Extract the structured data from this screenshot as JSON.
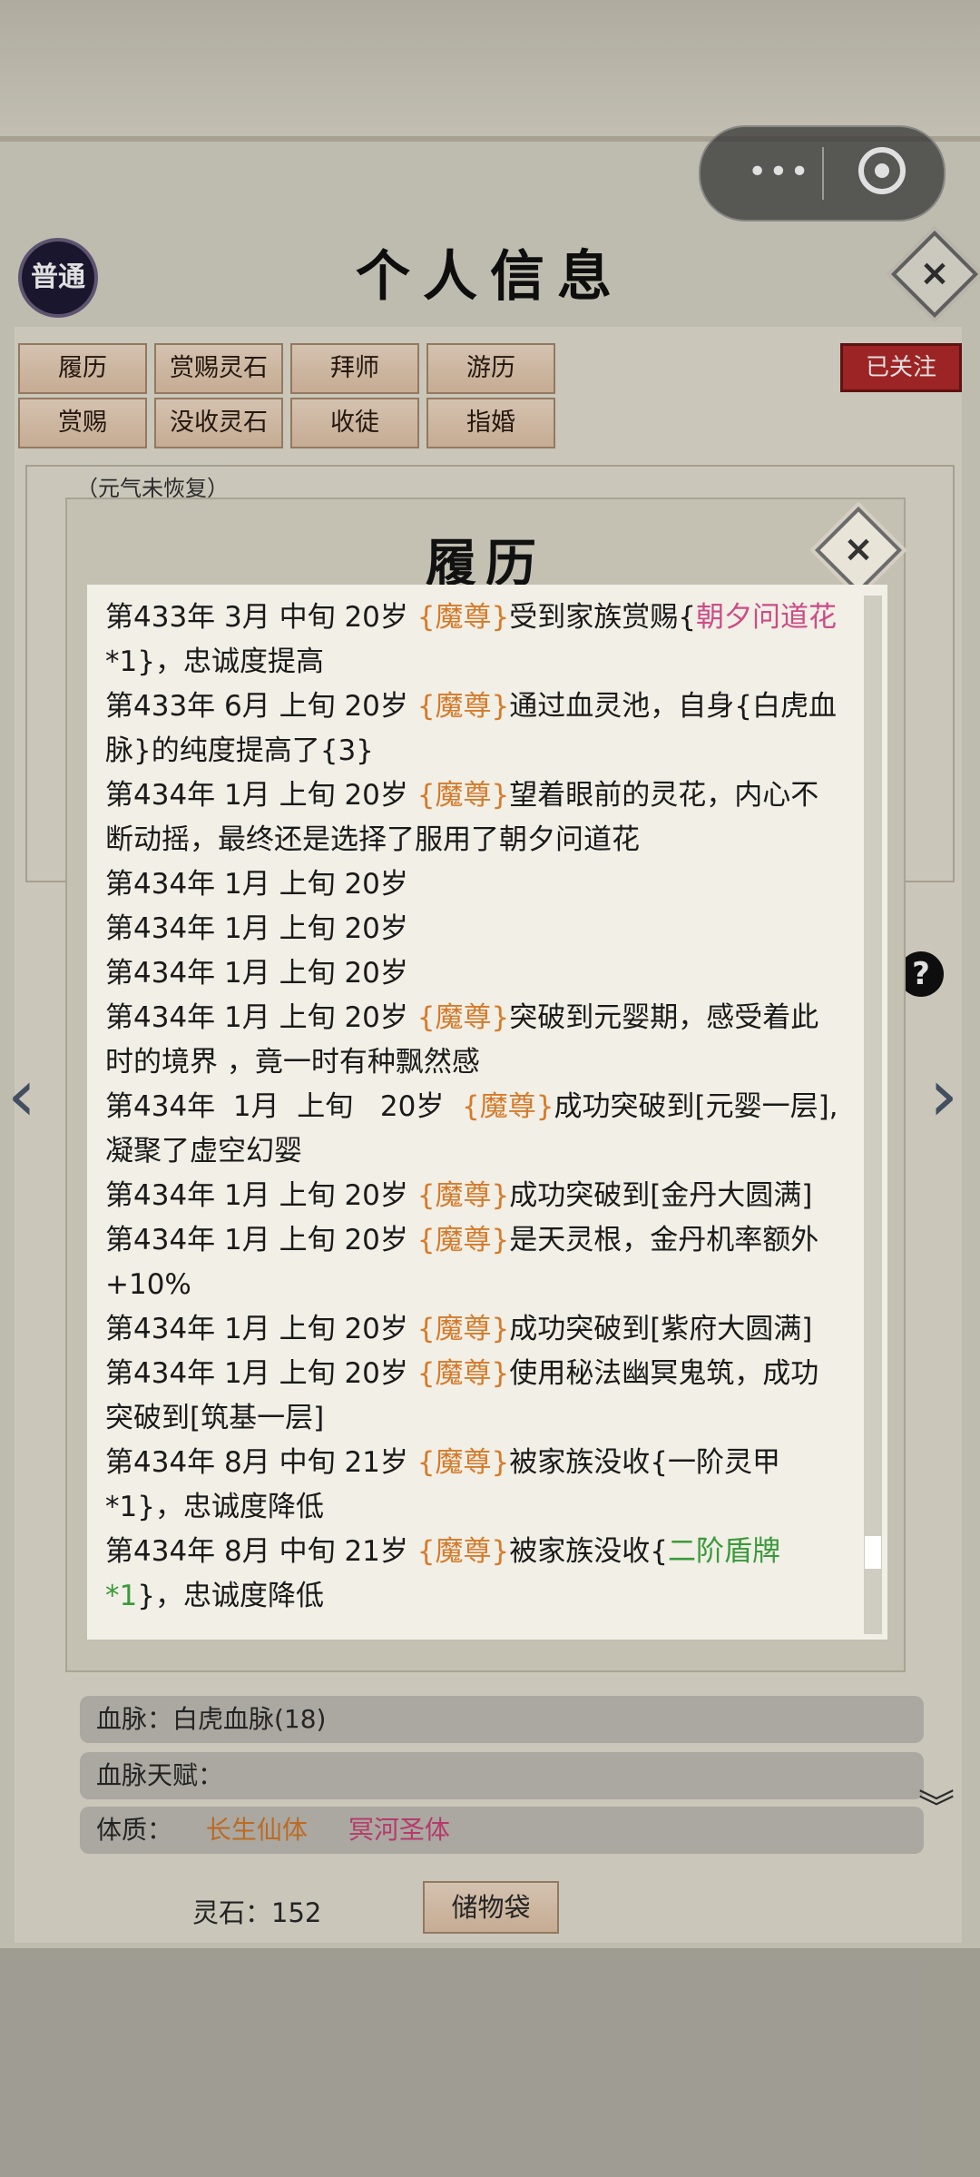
{
  "header": {
    "title": "个人信息",
    "mode_badge": "普通"
  },
  "actions": {
    "row1": [
      "履历",
      "赏赐灵石",
      "拜师",
      "游历"
    ],
    "row2": [
      "赏赐",
      "没收灵石",
      "收徒",
      "指婚"
    ],
    "follow": "已关注"
  },
  "profile": {
    "vitality": "（元气未恢复）",
    "bloodline": "血脉：白虎血脉(18)",
    "bloodline_talent": "血脉天赋：",
    "physique_label": "体质：",
    "physique_items": [
      "长生仙体",
      "冥河圣体"
    ],
    "spirit_stones": "灵石：152",
    "storage_bag": "储物袋"
  },
  "modal": {
    "title": "履历",
    "entries": [
      {
        "date": "第433年 3月 中旬 20岁 ",
        "tag": "{魔尊}",
        "text": "受到家族赏赐{",
        "item": "朝夕问道花",
        "item_color": "pink",
        "tail": "*1}，忠诚度提高"
      },
      {
        "date": "第433年 6月 上旬 20岁 ",
        "tag": "{魔尊}",
        "text": "通过血灵池，自身{白虎血脉}的纯度提高了{3}"
      },
      {
        "date": "第434年 1月 上旬 20岁 ",
        "tag": "{魔尊}",
        "text": "望着眼前的灵花，内心不断动摇，最终还是选择了服用了朝夕问道花"
      },
      {
        "date": "第434年 1月 上旬 20岁"
      },
      {
        "date": "第434年 1月 上旬 20岁"
      },
      {
        "date": "第434年 1月 上旬 20岁"
      },
      {
        "date": "第434年 1月 上旬 20岁 ",
        "tag": "{魔尊}",
        "text": "突破到元婴期，感受着此时的境界 ，竟一时有种飘然感"
      },
      {
        "date": "第434年  1月  上旬   20岁  ",
        "tag": "{魔尊}",
        "text": "成功突破到[元婴一层],凝聚了虚空幻婴"
      },
      {
        "date": "第434年 1月 上旬 20岁 ",
        "tag": "{魔尊}",
        "text": "成功突破到[金丹大圆满]"
      },
      {
        "date": "第434年 1月 上旬 20岁 ",
        "tag": "{魔尊}",
        "text": "是天灵根，金丹机率额外+10%"
      },
      {
        "date": "第434年 1月 上旬 20岁 ",
        "tag": "{魔尊}",
        "text": "成功突破到[紫府大圆满]"
      },
      {
        "date": "第434年 1月 上旬 20岁 ",
        "tag": "{魔尊}",
        "text": "使用秘法幽冥鬼筑，成功突破到[筑基一层]"
      },
      {
        "date": "第434年 8月 中旬 21岁 ",
        "tag": "{魔尊}",
        "text": "被家族没收{一阶灵甲*1}，忠诚度降低"
      },
      {
        "date": "第434年 8月 中旬 21岁 ",
        "tag": "{魔尊}",
        "text": "被家族没收{",
        "item": "二阶盾牌*1",
        "item_color": "green",
        "tail": "}，忠诚度降低"
      }
    ]
  },
  "colors": {
    "tag": "#d67a2a",
    "pink_item": "#cc4c86",
    "green_item": "#3a9a3a",
    "follow_red": "#b32a2a"
  }
}
